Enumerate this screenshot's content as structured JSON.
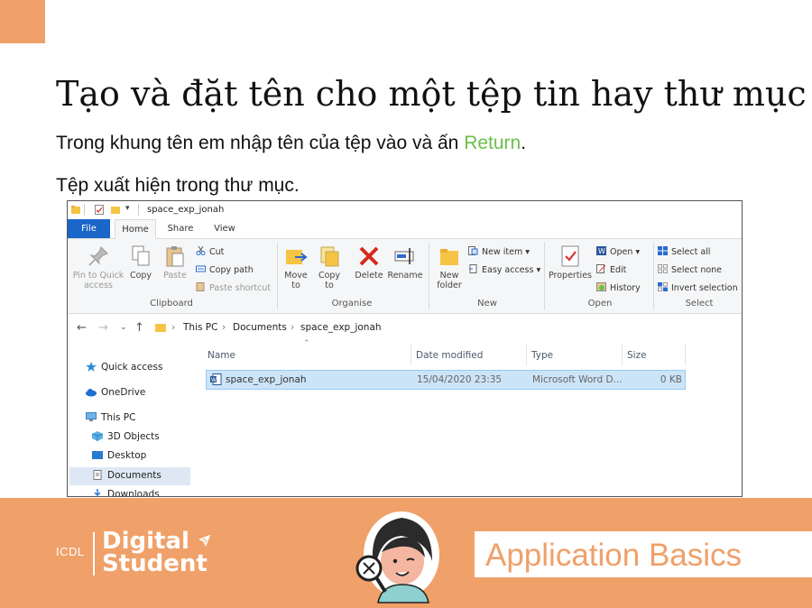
{
  "slide": {
    "title": "Tạo và đặt tên cho một tệp tin hay thư mục",
    "line1_before": "Trong khung tên em nhập tên của tệp vào và ấn ",
    "line1_highlight": "Return",
    "line1_after": ".",
    "line2": "Tệp xuất hiện trong thư mục.",
    "highlight_color": "#6cbf4a"
  },
  "explorer": {
    "window_title": "space_exp_jonah",
    "tabs": [
      "File",
      "Home",
      "Share",
      "View"
    ],
    "ribbon": {
      "clipboard": {
        "pin": "Pin to Quick access",
        "copy": "Copy",
        "paste": "Paste",
        "cut": "Cut",
        "copy_path": "Copy path",
        "paste_shortcut": "Paste shortcut",
        "label": "Clipboard"
      },
      "organise": {
        "move_to": "Move to",
        "copy_to": "Copy to",
        "delete": "Delete",
        "rename": "Rename",
        "label": "Organise"
      },
      "new": {
        "new_folder": "New folder",
        "new_item": "New item",
        "easy_access": "Easy access",
        "label": "New"
      },
      "open": {
        "properties": "Properties",
        "open": "Open",
        "edit": "Edit",
        "history": "History",
        "label": "Open"
      },
      "select": {
        "select_all": "Select all",
        "select_none": "Select none",
        "invert": "Invert selection",
        "label": "Select"
      }
    },
    "breadcrumb": [
      "This PC",
      "Documents",
      "space_exp_jonah"
    ],
    "nav": {
      "quick_access": "Quick access",
      "onedrive": "OneDrive",
      "this_pc": "This PC",
      "objects3d": "3D Objects",
      "desktop": "Desktop",
      "documents": "Documents",
      "downloads": "Downloads"
    },
    "columns": [
      "Name",
      "Date modified",
      "Type",
      "Size"
    ],
    "files": [
      {
        "name": "space_exp_jonah",
        "date": "15/04/2020 23:35",
        "type": "Microsoft Word D...",
        "size": "0 KB"
      }
    ]
  },
  "footer": {
    "icdl": "ICDL",
    "brand_line1": "Digital",
    "brand_line2": "Student",
    "banner": "Application Basics",
    "accent_color": "#f0a069"
  }
}
